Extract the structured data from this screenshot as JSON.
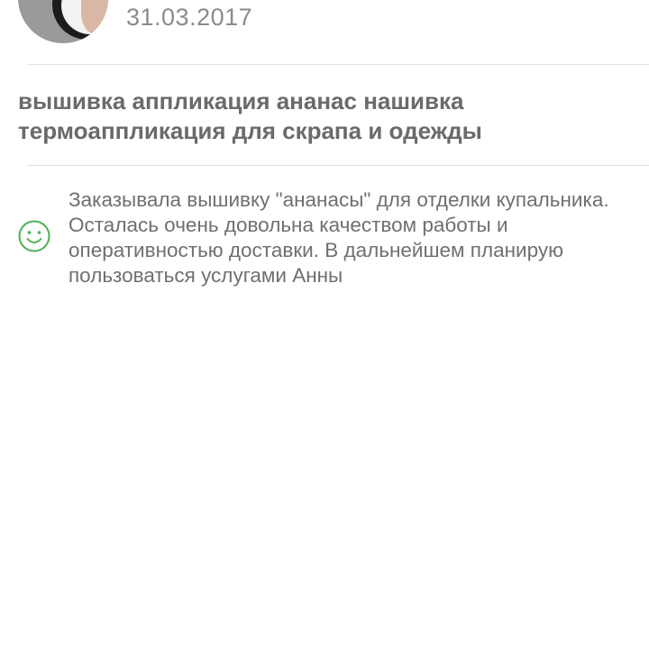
{
  "review": {
    "date": "31.03.2017",
    "product_title": "вышивка аппликация ананас нашивка термоаппликация для скрапа и одежды",
    "rating_icon": "smile-icon",
    "rating_color": "#4caf50",
    "text": "Заказывала вышивку \"ананасы\" для отделки купальника. Осталась очень довольна качеством работы и оперативностью доставки. В дальнейшем планирую пользоваться услугами Анны"
  }
}
